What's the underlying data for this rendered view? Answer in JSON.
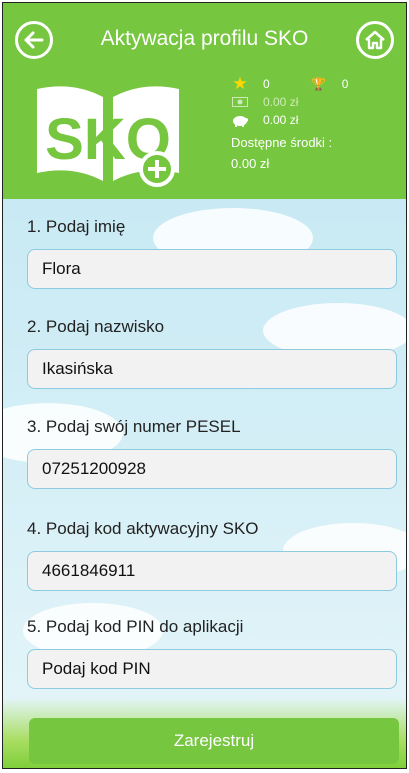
{
  "header": {
    "title": "Aktywacja profilu SKO",
    "back_icon": "arrow-left-icon",
    "home_icon": "home-icon"
  },
  "logo": {
    "text": "SKO"
  },
  "stats": {
    "stars": "0",
    "trophies": "0",
    "savings": "0.00 zł",
    "piggy": "0.00 zł",
    "available_label": "Dostępne środki :",
    "available_value": "0.00 zł"
  },
  "form": {
    "first_name": {
      "label": "1. Podaj imię",
      "value": "Flora"
    },
    "last_name": {
      "label": "2. Podaj nazwisko",
      "value": "Ikasińska"
    },
    "pesel": {
      "label": "3. Podaj swój numer PESEL",
      "value": "07251200928"
    },
    "activation_code": {
      "label": "4. Podaj kod aktywacyjny SKO",
      "value": "4661846911"
    },
    "pin": {
      "label": "5. Podaj kod PIN do aplikacji",
      "placeholder": "Podaj kod PIN"
    },
    "submit_label": "Zarejestruj"
  },
  "colors": {
    "brand_green": "#76c640",
    "sky": "#cfeaf4",
    "star": "#ffd800"
  }
}
